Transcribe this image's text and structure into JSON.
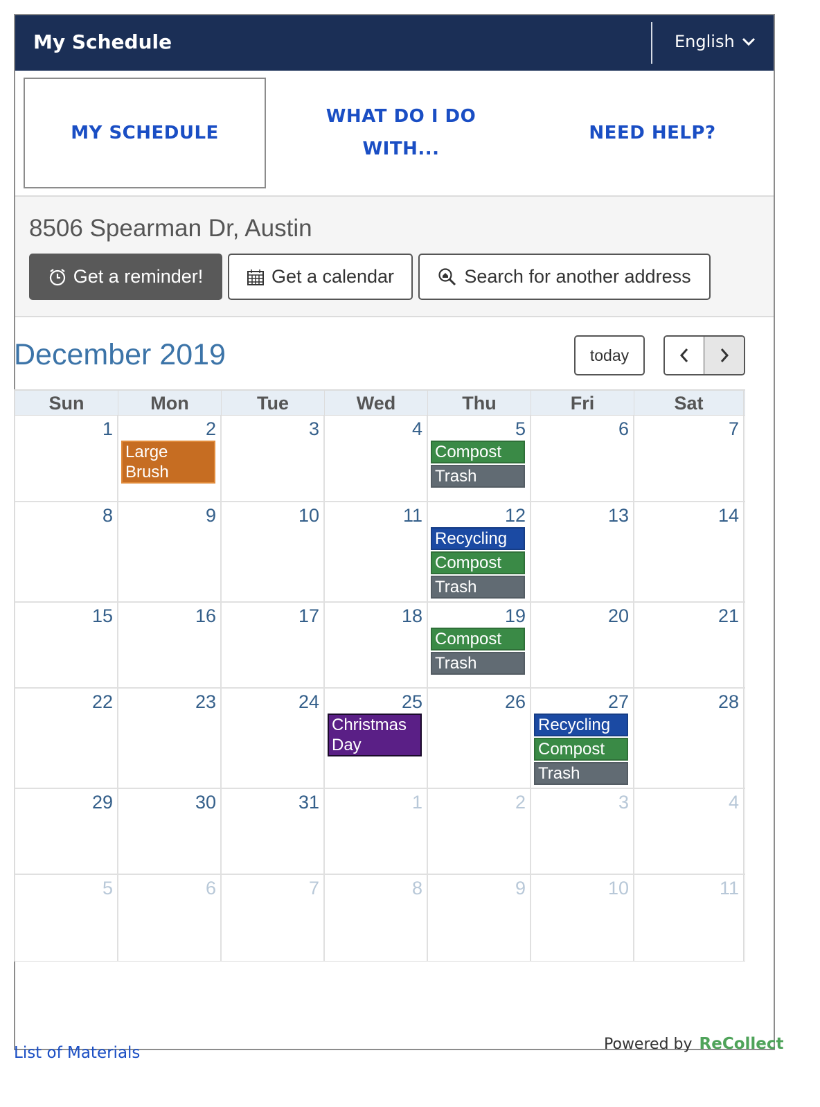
{
  "header": {
    "title": "My Schedule",
    "language": "English"
  },
  "nav": {
    "tabs": [
      {
        "label": "MY SCHEDULE"
      },
      {
        "label": "WHAT DO I DO WITH..."
      },
      {
        "label": "NEED HELP?"
      }
    ]
  },
  "address": {
    "text": "8506 Spearman Dr, Austin",
    "buttons": {
      "reminder": "Get a reminder!",
      "calendar": "Get a calendar",
      "search": "Search for another address"
    }
  },
  "calendar": {
    "month_label": "December 2019",
    "today_label": "today",
    "weekdays": [
      "Sun",
      "Mon",
      "Tue",
      "Wed",
      "Thu",
      "Fri",
      "Sat"
    ],
    "weeks": [
      [
        "1",
        "2",
        "3",
        "4",
        "5",
        "6",
        "7"
      ],
      [
        "8",
        "9",
        "10",
        "11",
        "12",
        "13",
        "14"
      ],
      [
        "15",
        "16",
        "17",
        "18",
        "19",
        "20",
        "21"
      ],
      [
        "22",
        "23",
        "24",
        "25",
        "26",
        "27",
        "28"
      ],
      [
        "29",
        "30",
        "31",
        "1",
        "2",
        "3",
        "4"
      ],
      [
        "5",
        "6",
        "7",
        "8",
        "9",
        "10",
        "11"
      ]
    ],
    "events": {
      "dec2": [
        "Large Brush Collection"
      ],
      "dec5": [
        "Compost",
        "Trash"
      ],
      "dec12": [
        "Recycling",
        "Compost",
        "Trash"
      ],
      "dec19": [
        "Compost",
        "Trash"
      ],
      "dec25": [
        "Christmas Day"
      ],
      "dec27": [
        "Recycling",
        "Compost",
        "Trash"
      ]
    },
    "colors": {
      "compost": "#3a8a46",
      "trash": "#616b73",
      "recycling": "#1b4aa3",
      "brush": "#c66d22",
      "holiday": "#5a1f86"
    }
  },
  "footer": {
    "materials_link": "List of Materials",
    "powered_by": "Powered by",
    "brand": "ReCollect"
  }
}
